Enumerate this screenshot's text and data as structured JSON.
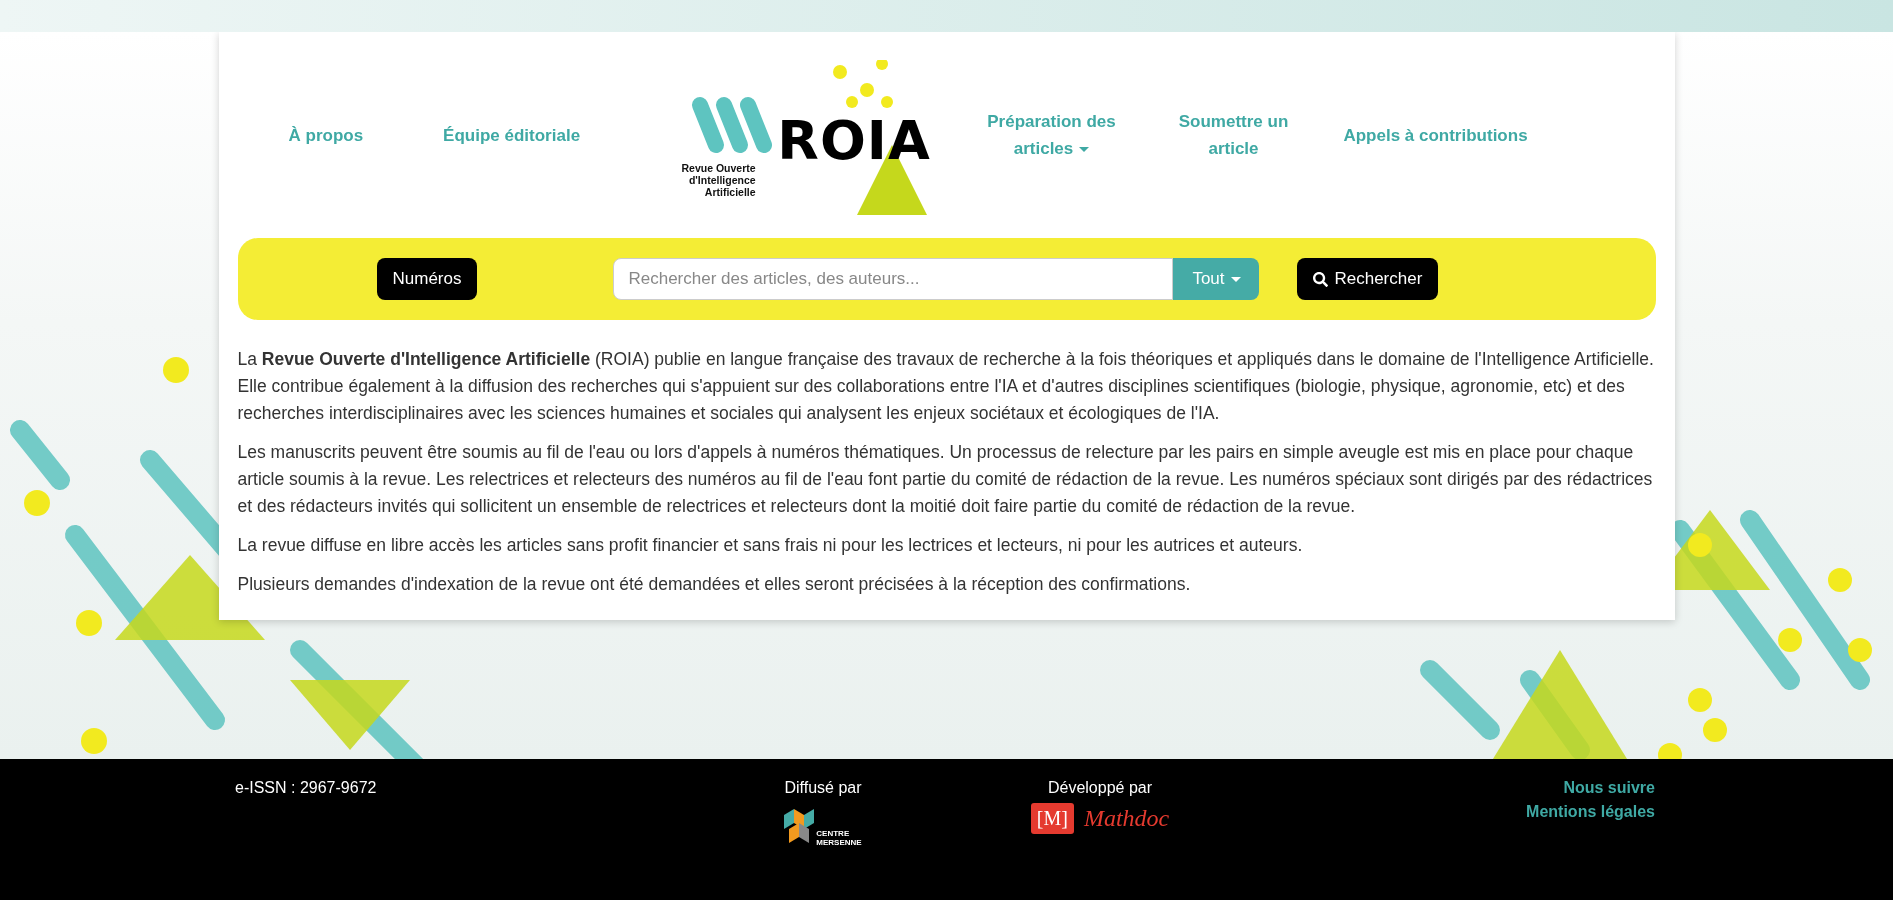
{
  "nav_left": [
    {
      "label": "À propos",
      "kind": "link"
    },
    {
      "label": "Équipe éditoriale",
      "kind": "link"
    }
  ],
  "logo": {
    "letters": "ROIA",
    "tagline": [
      "Revue Ouverte",
      "d'Intelligence",
      "Artificielle"
    ]
  },
  "nav_right": [
    {
      "label": "Préparation des articles",
      "kind": "dropdown"
    },
    {
      "label": "Soumettre un article",
      "kind": "link"
    },
    {
      "label": "Appels à contributions",
      "kind": "link"
    }
  ],
  "search_bar": {
    "issues_button": "Numéros",
    "placeholder": "Rechercher des articles, des auteurs...",
    "scope": "Tout",
    "search_button": "Rechercher"
  },
  "paragraphs": [
    "La **Revue Ouverte d'Intelligence Artificielle** (ROIA) publie en langue française des travaux de recherche à la fois théoriques et appliqués dans le domaine de l'Intelligence Artificielle. Elle contribue également à la diffusion des recherches qui s'appuient sur des collaborations entre l'IA et d'autres disciplines scientifiques (biologie, physique, agronomie, etc) et des recherches interdisciplinaires avec les sciences humaines et sociales qui analysent les enjeux sociétaux et écologiques de l'IA.",
    "Les manuscrits peuvent être soumis au fil de l'eau ou lors d'appels à numéros thématiques. Un processus de relecture par les pairs en simple aveugle est mis en place pour chaque article soumis à la revue. Les relectrices et relecteurs des numéros au fil de l'eau font partie du comité de rédaction de la revue. Les numéros spéciaux sont dirigés par des rédactrices et des rédacteurs invités qui sollicitent un ensemble de relectrices et relecteurs dont la moitié doit faire partie du comité de rédaction de la revue.",
    "La revue diffuse en libre accès les articles sans profit financier et sans frais ni pour les lectrices et lecteurs, ni pour les autrices et auteurs.",
    "Plusieurs demandes d'indexation de la revue ont été demandées et elles seront précisées à la réception des confirmations."
  ],
  "footer": {
    "issn": "e-ISSN : 2967-9672",
    "distributed_by": {
      "label": "Diffusé par",
      "logo_lines": [
        "CENTRE",
        "MERSENNE"
      ]
    },
    "developed_by": {
      "label": "Développé par",
      "logo_mark": "[M]",
      "logo_name": "Mathdoc"
    },
    "links": [
      "Nous suivre",
      "Mentions légales"
    ]
  }
}
